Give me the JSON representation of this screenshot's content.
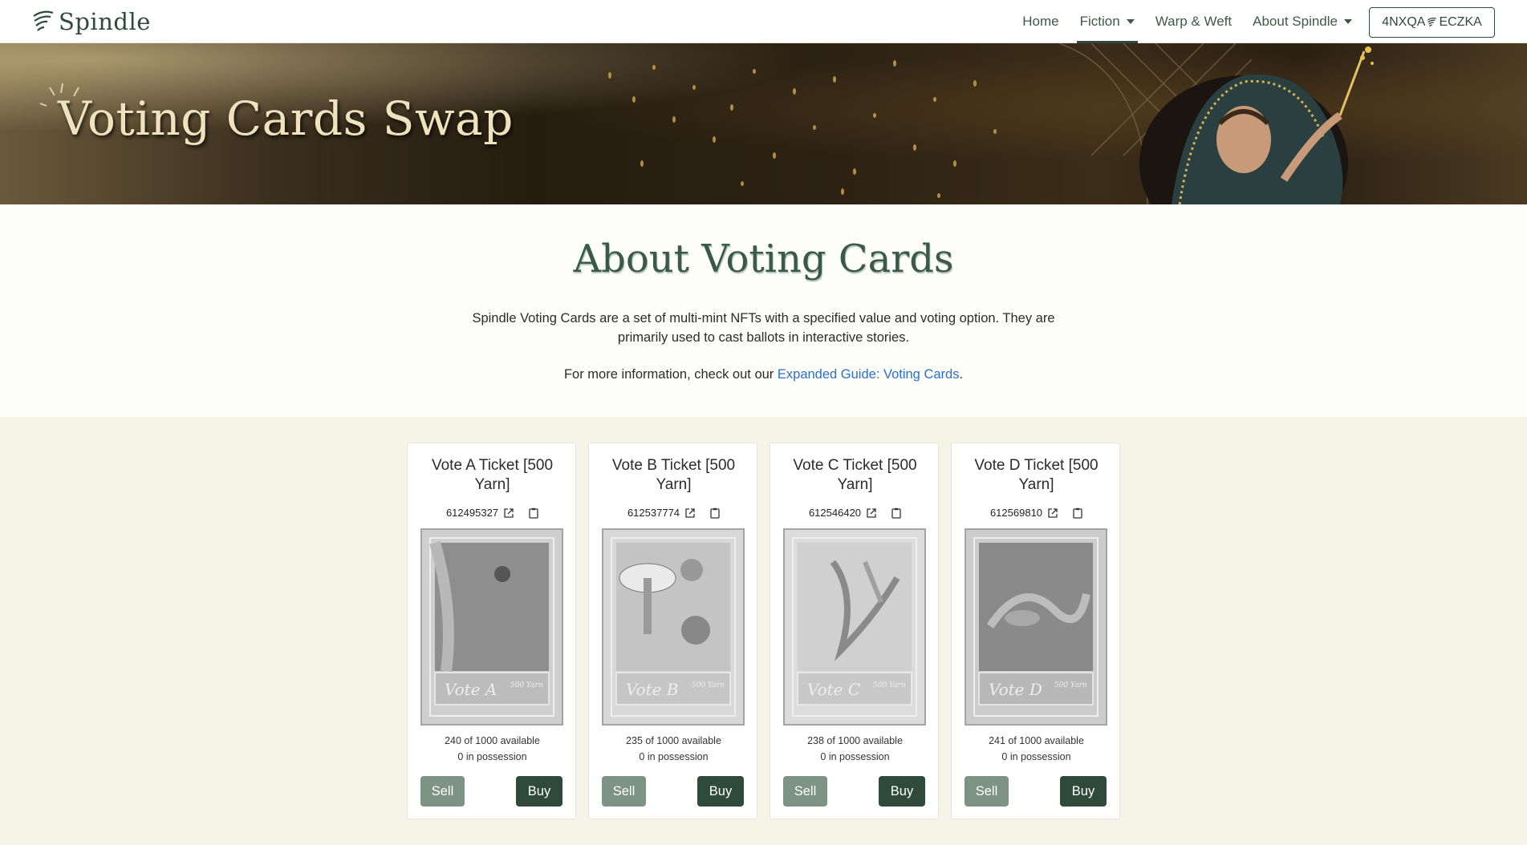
{
  "nav": {
    "brand": "Spindle",
    "links": [
      {
        "label": "Home",
        "dropdown": false,
        "active": false
      },
      {
        "label": "Fiction",
        "dropdown": true,
        "active": true
      },
      {
        "label": "Warp & Weft",
        "dropdown": false,
        "active": false
      },
      {
        "label": "About Spindle",
        "dropdown": true,
        "active": false
      }
    ],
    "account": {
      "prefix": "4NXQA",
      "suffix": "ECZKA"
    }
  },
  "hero": {
    "title": "Voting Cards Swap"
  },
  "about": {
    "title": "About Voting Cards",
    "description": "Spindle Voting Cards are a set of multi-mint NFTs with a specified value and voting option. They are primarily used to cast ballots in interactive stories.",
    "more_prefix": "For more information, check out our ",
    "more_link": "Expanded Guide: Voting Cards",
    "more_suffix": "."
  },
  "cards": [
    {
      "title": "Vote A Ticket [500 Yarn]",
      "asset_id": "612495327",
      "letter": "A",
      "card_text": "Vote A",
      "value_text": "500 Yarn",
      "available": "240 of 1000 available",
      "possession": "0 in possession",
      "sell": "Sell",
      "buy": "Buy"
    },
    {
      "title": "Vote B Ticket [500 Yarn]",
      "asset_id": "612537774",
      "letter": "B",
      "card_text": "Vote B",
      "value_text": "500 Yarn",
      "available": "235 of 1000 available",
      "possession": "0 in possession",
      "sell": "Sell",
      "buy": "Buy"
    },
    {
      "title": "Vote C Ticket [500 Yarn]",
      "asset_id": "612546420",
      "letter": "C",
      "card_text": "Vote C",
      "value_text": "500 Yarn",
      "available": "238 of 1000 available",
      "possession": "0 in possession",
      "sell": "Sell",
      "buy": "Buy"
    },
    {
      "title": "Vote D Ticket [500 Yarn]",
      "asset_id": "612569810",
      "letter": "D",
      "card_text": "Vote D",
      "value_text": "500 Yarn",
      "available": "241 of 1000 available",
      "possession": "0 in possession",
      "sell": "Sell",
      "buy": "Buy"
    }
  ],
  "colors": {
    "brand_green": "#2f4a3a",
    "sell_button": "#7d9383",
    "link_blue": "#2c6fce",
    "section_bg": "#f6f4e6"
  },
  "icons": [
    "spindle-logo-icon",
    "caret-down-icon",
    "external-link-icon",
    "clipboard-icon"
  ]
}
